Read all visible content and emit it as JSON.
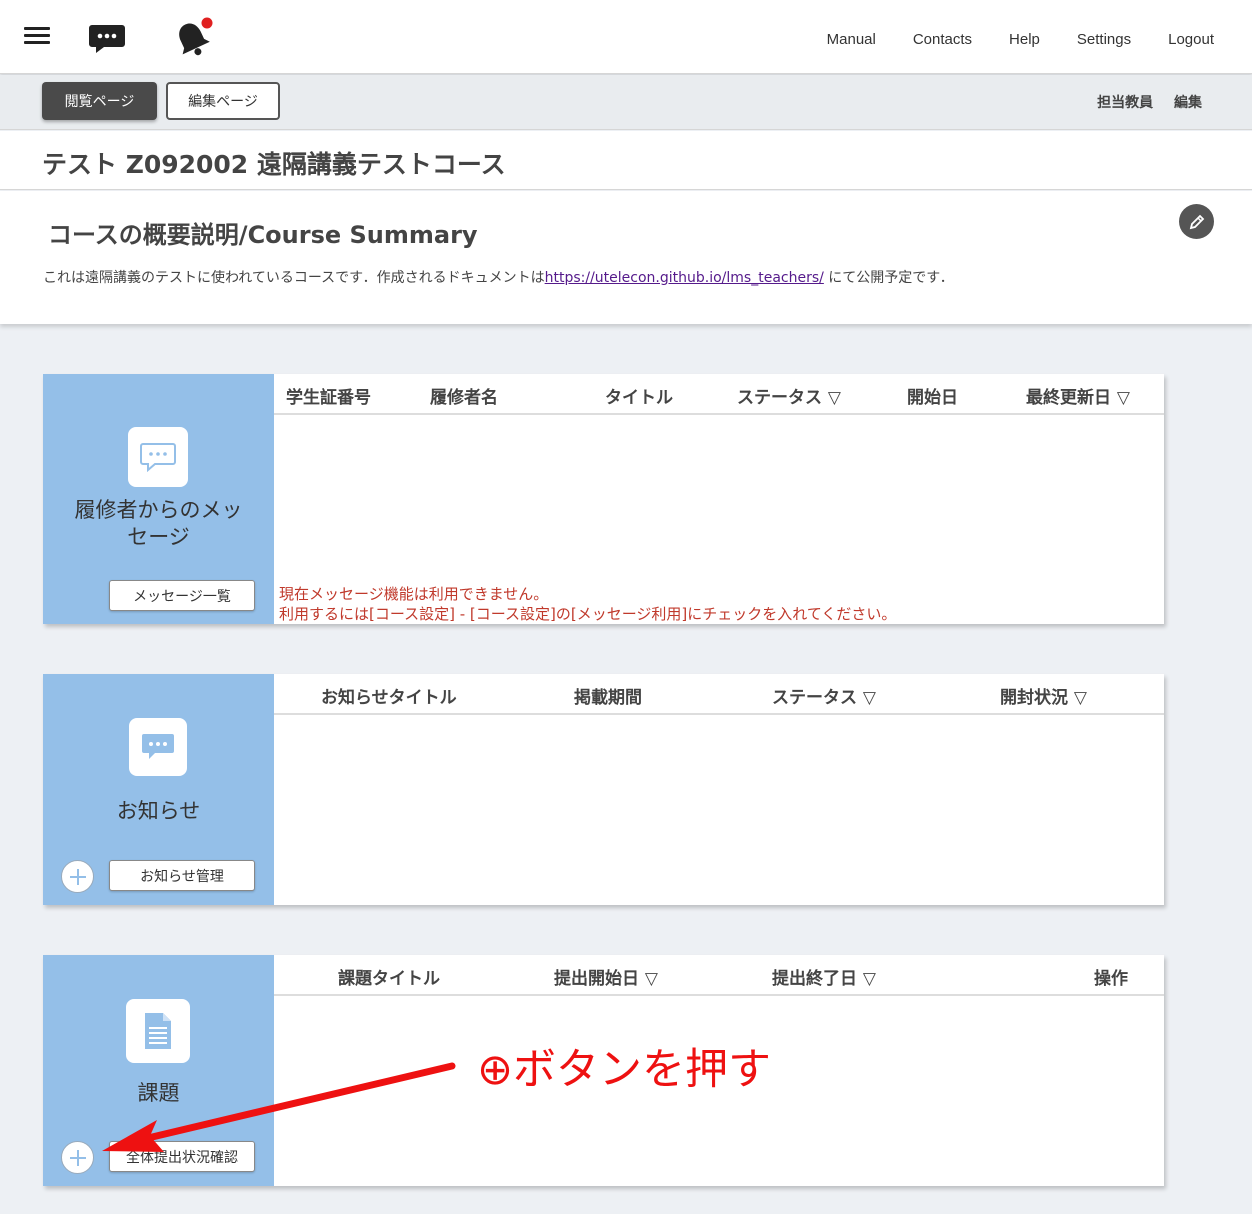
{
  "header": {
    "nav": [
      "Manual",
      "Contacts",
      "Help",
      "Settings",
      "Logout"
    ]
  },
  "subbar": {
    "view_page": "閲覧ページ",
    "edit_page": "編集ページ",
    "right": [
      "担当教員",
      "編集"
    ]
  },
  "course": {
    "title": "テスト Z092002 遠隔講義テストコース"
  },
  "summary": {
    "title": "コースの概要説明/Course Summary",
    "text_before": "これは遠隔講義のテストに使われているコースです．作成されるドキュメントは",
    "link": "https://utelecon.github.io/lms_teachers/",
    "text_after": " にて公開予定です．"
  },
  "messages": {
    "label_line1": "履修者からのメッ",
    "label_line2": "セージ",
    "button": "メッセージ一覧",
    "columns": [
      "学生証番号",
      "履修者名",
      "タイトル",
      "ステータス ▽",
      "開始日",
      "最終更新日 ▽"
    ],
    "notice_line1": "現在メッセージ機能は利用できません。",
    "notice_line2": "利用するには[コース設定] - [コース設定]の[メッセージ利用]にチェックを入れてください。"
  },
  "announcements": {
    "label": "お知らせ",
    "button": "お知らせ管理",
    "columns": [
      "お知らせタイトル",
      "掲載期間",
      "ステータス ▽",
      "開封状況 ▽"
    ]
  },
  "assignments": {
    "label": "課題",
    "button": "全体提出状況確認",
    "columns": [
      "課題タイトル",
      "提出開始日 ▽",
      "提出終了日 ▽",
      "操作"
    ]
  },
  "annotation": {
    "text": "⊕ボタンを押す",
    "color": "#ee1111"
  },
  "colors": {
    "panel_accent": "#94bfe8",
    "notice": "#c0392b"
  }
}
